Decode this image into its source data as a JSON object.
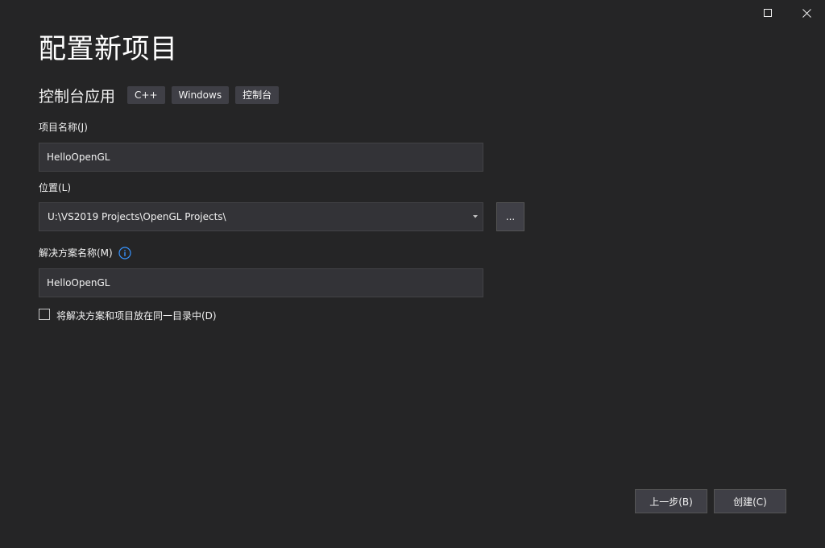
{
  "window": {
    "maximize_icon": "maximize-icon",
    "close_icon": "close-icon"
  },
  "title": "配置新项目",
  "template": {
    "name": "控制台应用",
    "tags": [
      "C++",
      "Windows",
      "控制台"
    ]
  },
  "project_name": {
    "label": "项目名称(J)",
    "value": "HelloOpenGL"
  },
  "location": {
    "label": "位置(L)",
    "value": "U:\\VS2019 Projects\\OpenGL Projects\\",
    "browse_label": "..."
  },
  "solution_name": {
    "label": "解决方案名称(M)",
    "info_icon": "info-icon",
    "value": "HelloOpenGL"
  },
  "same_directory": {
    "label": "将解决方案和项目放在同一目录中(D)",
    "checked": false
  },
  "footer": {
    "back_label": "上一步(B)",
    "create_label": "创建(C)"
  },
  "colors": {
    "background": "#252526",
    "input_background": "#333337",
    "button_background": "#3f3f46",
    "info_accent": "#3794ff"
  }
}
